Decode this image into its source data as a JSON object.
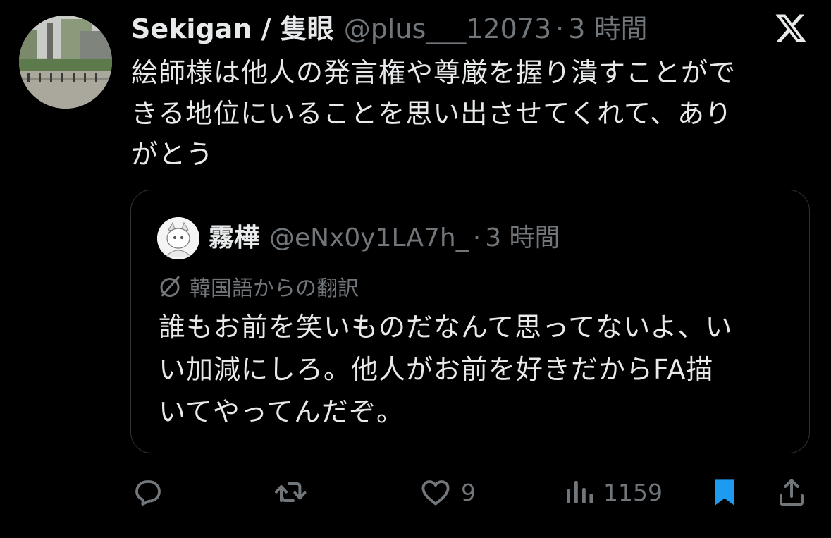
{
  "tweet": {
    "display_name": "Sekigan / 隻眼",
    "handle": "@plus___12073",
    "separator": "·",
    "timestamp": "3 時間",
    "text_lines": [
      "絵師様は他人の発言権や尊厳を握り潰すことがで",
      "きる地位にいることを思い出させてくれて、あり",
      "がとう"
    ]
  },
  "quote": {
    "display_name": "霧樺",
    "handle": "@eNx0y1LA7h_",
    "separator": "·",
    "timestamp": "3 時間",
    "translation_label": "韓国語からの翻訳",
    "text_lines": [
      "誰もお前を笑いものだなんて思ってないよ、い",
      "い加減にしろ。他人がお前を好きだからFA描",
      "いてやってんだぞ。"
    ]
  },
  "actions": {
    "likes": "9",
    "views": "1159"
  },
  "icons": {
    "logo": "x-logo-icon",
    "reply": "reply-icon",
    "retweet": "retweet-icon",
    "like": "heart-icon",
    "views": "views-icon",
    "bookmark": "bookmark-icon",
    "share": "share-icon",
    "translate": "globe-slash-icon"
  },
  "colors": {
    "background": "#000000",
    "text": "#e7e9ea",
    "secondary": "#71767b",
    "border": "#2f3336",
    "accent": "#1d9bf0"
  }
}
